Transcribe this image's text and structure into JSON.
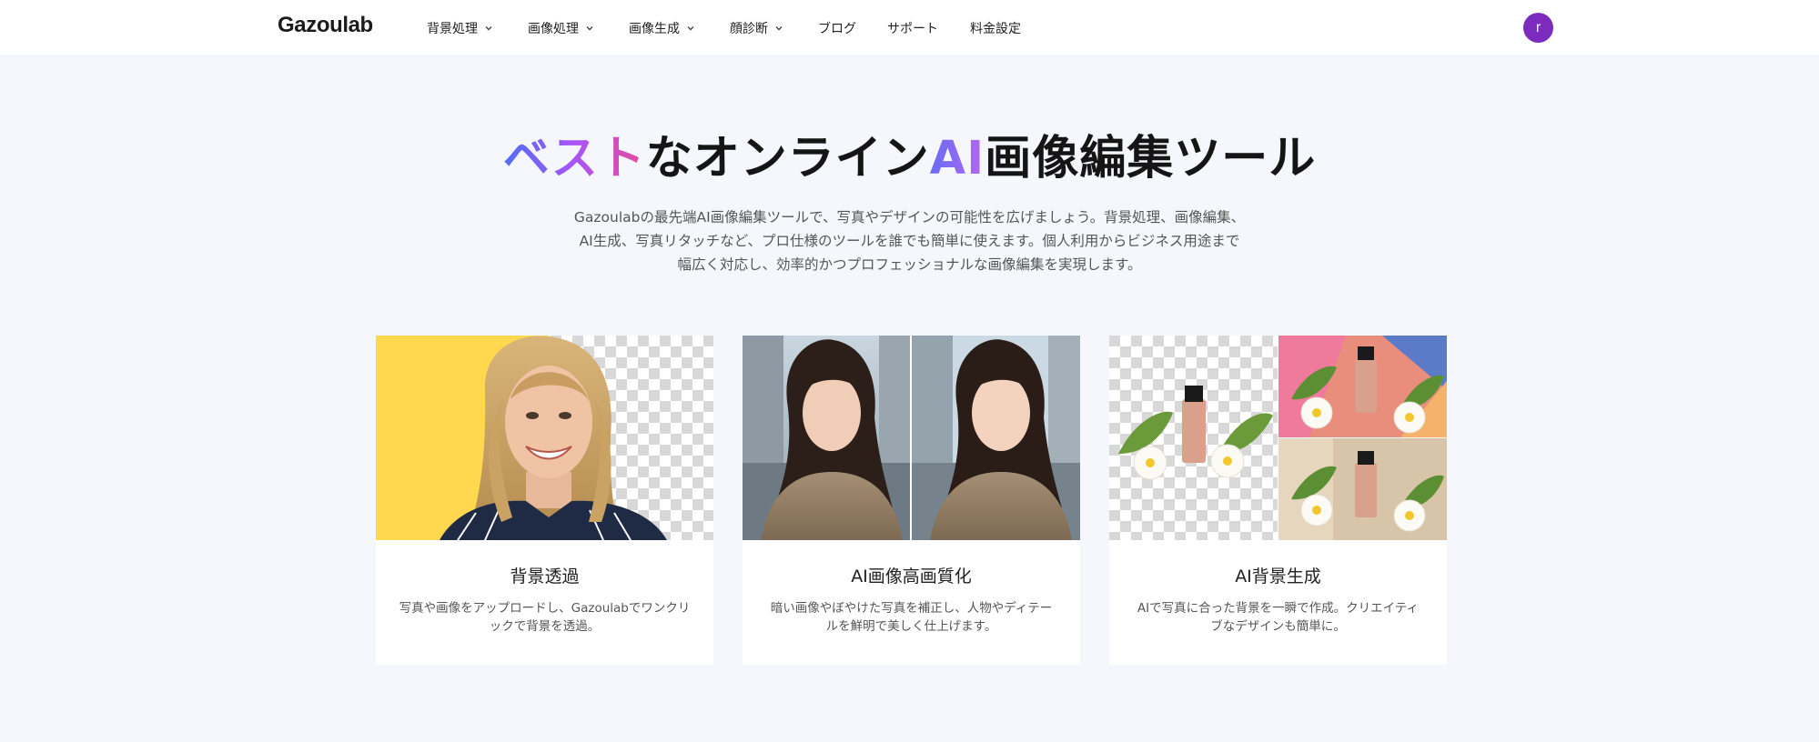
{
  "header": {
    "logo": "Gazoulab",
    "nav": [
      {
        "label": "背景処理",
        "dropdown": true
      },
      {
        "label": "画像処理",
        "dropdown": true
      },
      {
        "label": "画像生成",
        "dropdown": true
      },
      {
        "label": "顔診断",
        "dropdown": true
      },
      {
        "label": "ブログ",
        "dropdown": false
      },
      {
        "label": "サポート",
        "dropdown": false
      },
      {
        "label": "料金設定",
        "dropdown": false
      }
    ],
    "avatar_initial": "r"
  },
  "hero": {
    "title_part1": "ベスト",
    "title_part2": "なオンライン",
    "title_part3": "AI",
    "title_part4": "画像編集ツール",
    "desc_lines": [
      "Gazoulabの最先端AI画像編集ツールで、写真やデザインの可能性を広げましょう。背景処理、画像編集、",
      "AI生成、写真リタッチなど、プロ仕様のツールを誰でも簡単に使えます。個人利用からビジネス用途まで",
      "幅広く対応し、効率的かつプロフェッショナルな画像編集を実現します。"
    ]
  },
  "cards": [
    {
      "title": "背景透過",
      "desc": "写真や画像をアップロードし、Gazoulabでワンクリックで背景を透過。"
    },
    {
      "title": "AI画像高画質化",
      "desc": "暗い画像やぼやけた写真を補正し、人物やディテールを鮮明で美しく仕上げます。"
    },
    {
      "title": "AI背景生成",
      "desc": "AIで写真に合った背景を一瞬で作成。クリエイティブなデザインも簡単に。"
    }
  ],
  "colors": {
    "brand_gradient_start": "#4f6ff5",
    "brand_gradient_mid": "#a855f7",
    "brand_gradient_end": "#e94b9c",
    "avatar_bg": "#7b2cbf",
    "page_bg": "#f5f7fc"
  },
  "icons": {
    "nav_dropdown": "chevron-down-icon",
    "avatar": "user-avatar"
  }
}
